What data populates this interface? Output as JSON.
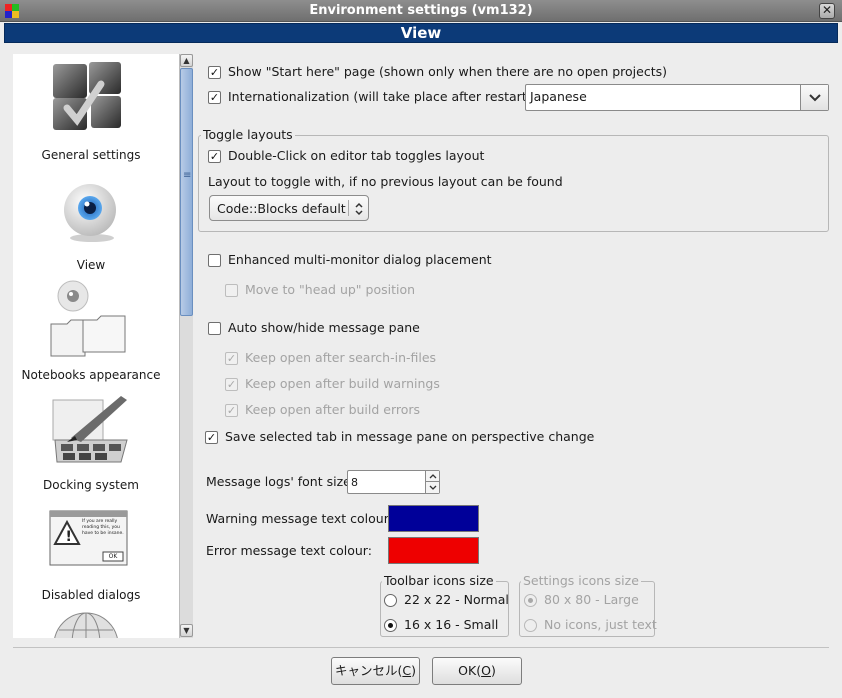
{
  "window": {
    "title": "Environment settings (vm132)",
    "close_glyph": "✕",
    "header": "View"
  },
  "categories": [
    {
      "label": "General settings",
      "icon": "general-settings-icon"
    },
    {
      "label": "View",
      "icon": "view-eye-icon"
    },
    {
      "label": "Notebooks appearance",
      "icon": "notebooks-folders-icon"
    },
    {
      "label": "Docking system",
      "icon": "docking-palette-icon"
    },
    {
      "label": "Disabled dialogs",
      "icon": "warning-dialog-icon"
    },
    {
      "label": "",
      "icon": "globe-icon"
    }
  ],
  "dialog_icon_text": "If you are really reading this, you have to be insane.",
  "dialog_icon_ok": "OK",
  "options": {
    "show_start_here": {
      "label": "Show \"Start here\" page (shown only when there are no open projects)",
      "checked": true
    },
    "internationalization": {
      "label": "Internationalization (will take place after restart)",
      "checked": true
    },
    "language": {
      "value": "Japanese"
    },
    "toggle_layouts": {
      "title": "Toggle layouts",
      "double_click": {
        "label": "Double-Click on editor tab toggles layout",
        "checked": true
      },
      "fallback_label": "Layout to toggle with, if no previous layout can be found",
      "fallback_value": "Code::Blocks default"
    },
    "multi_monitor": {
      "label": "Enhanced multi-monitor dialog placement",
      "checked": false
    },
    "head_up": {
      "label": "Move to \"head up\" position",
      "checked": false,
      "enabled": false
    },
    "auto_show_hide": {
      "label": "Auto show/hide message pane",
      "checked": false
    },
    "keep_search": {
      "label": "Keep open after search-in-files",
      "checked": true,
      "enabled": false
    },
    "keep_warnings": {
      "label": "Keep open after build warnings",
      "checked": true,
      "enabled": false
    },
    "keep_errors": {
      "label": "Keep open after build errors",
      "checked": true,
      "enabled": false
    },
    "save_selected_tab": {
      "label": "Save selected tab in message pane on perspective change",
      "checked": true
    },
    "font_size": {
      "label": "Message logs' font size:",
      "value": "8"
    },
    "warning_colour": {
      "label": "Warning message text colour:",
      "color": "#000099"
    },
    "error_colour": {
      "label": "Error message text colour:",
      "color": "#ee0000"
    },
    "toolbar_icons": {
      "title": "Toolbar icons size",
      "options": [
        "22 x 22 - Normal",
        "16 x 16 - Small"
      ],
      "selected": 1
    },
    "settings_icons": {
      "title": "Settings icons size",
      "options": [
        "80 x 80 - Large",
        "No icons, just text"
      ],
      "selected": 0,
      "enabled": false
    }
  },
  "buttons": {
    "cancel": {
      "label": "キャンセル(",
      "mnemonic": "C",
      "suffix": ")"
    },
    "ok": {
      "label": "OK(",
      "mnemonic": "O",
      "suffix": ")"
    }
  },
  "checkmark": "✓",
  "scroll_up": "▲",
  "scroll_down": "▼",
  "grip": "≡"
}
